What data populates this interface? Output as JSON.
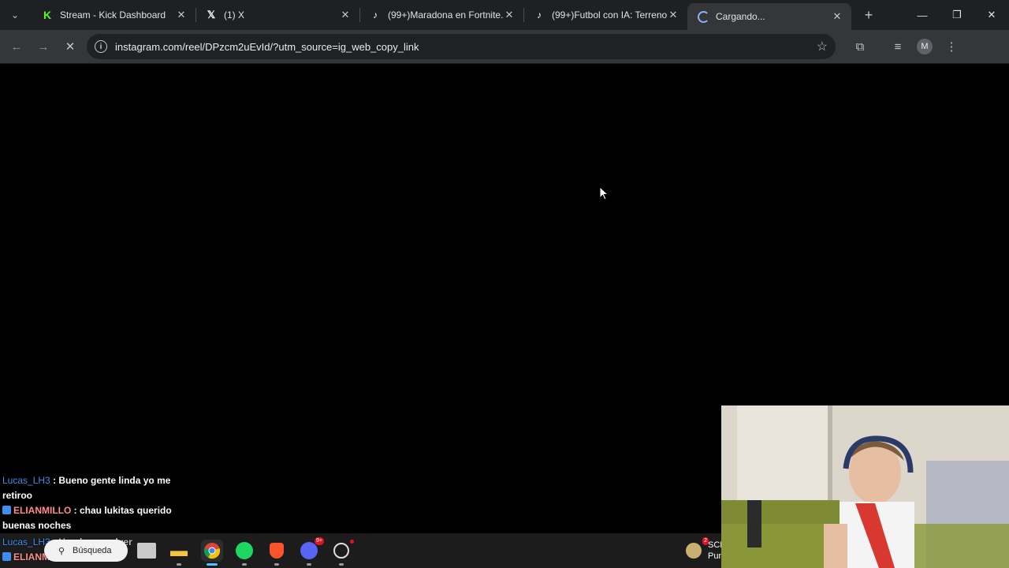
{
  "tabs": [
    {
      "title": "Stream - Kick Dashboard",
      "favicon": "kick-icon",
      "active": false
    },
    {
      "title": "(1) X",
      "favicon": "x-icon",
      "active": false
    },
    {
      "title": "(99+)Maradona en Fortnite.",
      "favicon": "tiktok-icon",
      "active": false
    },
    {
      "title": "(99+)Futbol con IA: Terreno",
      "favicon": "tiktok-icon",
      "active": false
    },
    {
      "title": "Cargando...",
      "favicon": "loading-spinner-icon",
      "active": true
    }
  ],
  "toolbar": {
    "url": "instagram.com/reel/DPzcm2uEvId/?utm_source=ig_web_copy_link",
    "profile_initial": "M"
  },
  "chat": {
    "messages": [
      {
        "user": "Lucas_LH3",
        "text": ": Bueno gente linda yo me retiroo",
        "color": "#3d8ef0"
      },
      {
        "user": "ELIANMILLO",
        "text": ": chau lukitas querido buenas noches",
        "color": "#ff8c8c"
      },
      {
        "user": "Lucas_LH3",
        "text": ": Un placer volver",
        "color": "#3d8ef0"
      },
      {
        "user": "ELIANMILLO",
        "text": ":",
        "color": "#ff8c8c"
      }
    ]
  },
  "taskbar": {
    "search_label": "Búsqueda",
    "discord_badge": "9+",
    "tray_badge": "2",
    "tray_text_1": "SCF",
    "tray_text_2": "Pun"
  }
}
